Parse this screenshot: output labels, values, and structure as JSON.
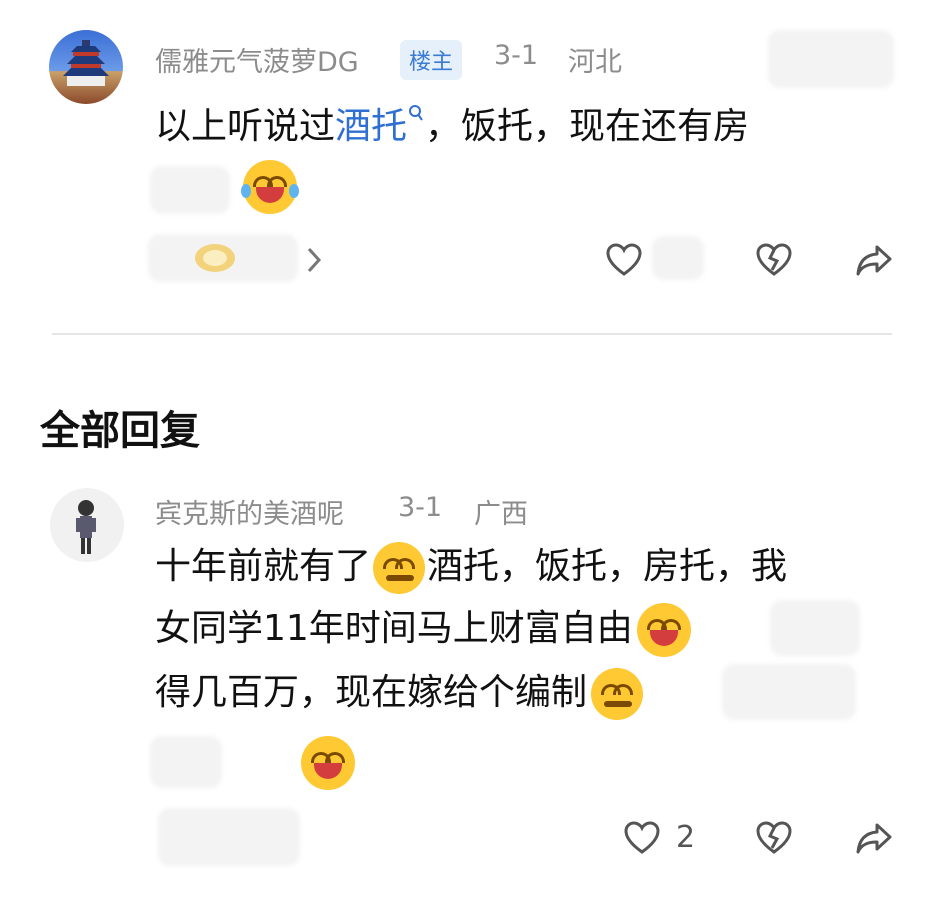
{
  "post": {
    "author": "儒雅元气菠萝DG",
    "badge": "楼主",
    "date": "3-1",
    "location": "河北",
    "text_prefix": "以上听说过",
    "link_text": "酒托",
    "text_suffix": "，饭托，现在还有房"
  },
  "section": {
    "title": "全部回复"
  },
  "reply": {
    "author": "宾克斯的美酒呢",
    "date": "3-1",
    "location": "广西",
    "line1": "十年前就有了",
    "line1b": "酒托，饭托，房托，我",
    "line2": "女同学11年时间马上财富自由",
    "line3": "得几百万，现在嫁给个编制",
    "like_count": "2"
  },
  "icons": {
    "heart": "heart-icon",
    "broken_heart": "broken-heart-icon",
    "share": "share-icon",
    "chevron": "chevron-right-icon",
    "search_small": "search-small-icon"
  },
  "colors": {
    "accent": "#2f6fd1",
    "muted": "#8c8c8c",
    "badge_bg": "#e6f0fb"
  }
}
